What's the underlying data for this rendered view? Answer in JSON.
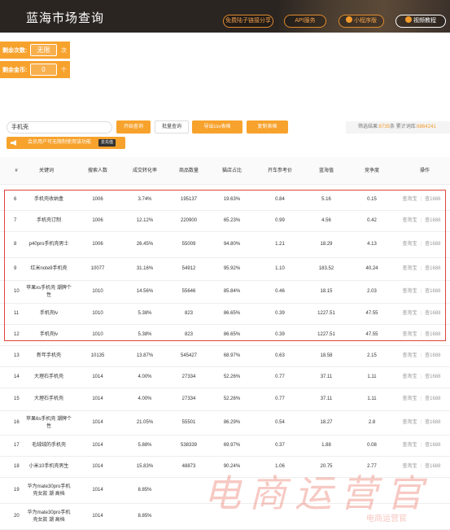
{
  "header": {
    "title": "蓝海市场查询",
    "nav": [
      "免费陆子链接分享",
      "API服务",
      "小程序版",
      "视频教程"
    ]
  },
  "quota": {
    "remain_times_label": "剩余次数:",
    "remain_times_value": "无限",
    "remain_times_unit": "次",
    "remain_coins_label": "剩余金币:",
    "remain_coins_value": "0",
    "remain_coins_unit": "个"
  },
  "search": {
    "value": "手机壳",
    "start_btn": "开始查询",
    "batch_btn": "批量查询",
    "export_btn": "导出csv表格",
    "copy_btn": "复制表格",
    "stats_prefix": "筛选结果:",
    "stats_count": "6735",
    "stats_mid": "条  累计词库:",
    "stats_total": "6864241"
  },
  "notice": {
    "text": "会员用户可无限制使用该功能",
    "go": "去充值"
  },
  "table": {
    "headers": [
      "#",
      "关键词",
      "搜索人数",
      "成交转化率",
      "商品数量",
      "猫店占比",
      "开车参考价",
      "蓝海值",
      "竞争度",
      "操作"
    ],
    "op_taobao": "查淘宝",
    "op_1688": "查1688",
    "rows": [
      {
        "idx": "6",
        "kw": "手机壳收纳盒",
        "search": "1006",
        "cvr": "3.74%",
        "goods": "195137",
        "tmall": "19.63%",
        "price": "0.84",
        "blue": "5.16",
        "comp": "0.15"
      },
      {
        "idx": "7",
        "kw": "手机壳订制",
        "search": "1006",
        "cvr": "12.12%",
        "goods": "220900",
        "tmall": "65.23%",
        "price": "0.99",
        "blue": "4.56",
        "comp": "0.42"
      },
      {
        "idx": "8",
        "kw": "p40pro手机壳男士",
        "search": "1006",
        "cvr": "26.45%",
        "goods": "55009",
        "tmall": "94.80%",
        "price": "1.21",
        "blue": "18.29",
        "comp": "4.13"
      },
      {
        "idx": "9",
        "kw": "红米note9手机壳",
        "search": "10077",
        "cvr": "31.16%",
        "goods": "54912",
        "tmall": "95.92%",
        "price": "1.10",
        "blue": "183.52",
        "comp": "40.24"
      },
      {
        "idx": "10",
        "kw": "苹果xs手机壳 潮牌个性",
        "search": "1010",
        "cvr": "14.56%",
        "goods": "55646",
        "tmall": "85.84%",
        "price": "0.46",
        "blue": "18.15",
        "comp": "2.03"
      },
      {
        "idx": "11",
        "kw": "手机壳lv",
        "search": "1010",
        "cvr": "5.38%",
        "goods": "823",
        "tmall": "86.65%",
        "price": "0.39",
        "blue": "1227.51",
        "comp": "47.55"
      },
      {
        "idx": "12",
        "kw": "手机壳lv",
        "search": "1010",
        "cvr": "5.38%",
        "goods": "823",
        "tmall": "86.65%",
        "price": "0.39",
        "blue": "1227.51",
        "comp": "47.55"
      },
      {
        "idx": "13",
        "kw": "新年手机壳",
        "search": "10135",
        "cvr": "13.87%",
        "goods": "545427",
        "tmall": "68.97%",
        "price": "0.63",
        "blue": "18.58",
        "comp": "2.15"
      },
      {
        "idx": "14",
        "kw": "大理石手机壳",
        "search": "1014",
        "cvr": "4.00%",
        "goods": "27334",
        "tmall": "52.26%",
        "price": "0.77",
        "blue": "37.11",
        "comp": "1.11"
      },
      {
        "idx": "15",
        "kw": "大理石手机壳",
        "search": "1014",
        "cvr": "4.00%",
        "goods": "27334",
        "tmall": "52.26%",
        "price": "0.77",
        "blue": "37.11",
        "comp": "1.11"
      },
      {
        "idx": "16",
        "kw": "苹果6s手机壳 潮牌个性",
        "search": "1014",
        "cvr": "21.05%",
        "goods": "55501",
        "tmall": "86.29%",
        "price": "0.54",
        "blue": "18.27",
        "comp": "2.8"
      },
      {
        "idx": "17",
        "kw": "毛绒绒的手机壳",
        "search": "1014",
        "cvr": "5.88%",
        "goods": "538339",
        "tmall": "69.97%",
        "price": "0.37",
        "blue": "1.88",
        "comp": "0.08"
      },
      {
        "idx": "18",
        "kw": "小米10手机壳男生",
        "search": "1014",
        "cvr": "15.83%",
        "goods": "48873",
        "tmall": "90.24%",
        "price": "1.06",
        "blue": "20.75",
        "comp": "2.77"
      },
      {
        "idx": "19",
        "kw": "华为mate30pro手机壳女款 潮 高档",
        "search": "1014",
        "cvr": "8.85%",
        "goods": "",
        "tmall": "",
        "price": "",
        "blue": "",
        "comp": ""
      },
      {
        "idx": "20",
        "kw": "华为mate30pro手机壳女款 潮 高档",
        "search": "1014",
        "cvr": "8.85%",
        "goods": "",
        "tmall": "",
        "price": "",
        "blue": "",
        "comp": ""
      }
    ]
  },
  "watermark": {
    "big": "电商运营官",
    "small": "电商运营官"
  },
  "colors": {
    "accent": "#f7a22c",
    "topbar": "#2b2521",
    "highlight": "#e0453a"
  }
}
